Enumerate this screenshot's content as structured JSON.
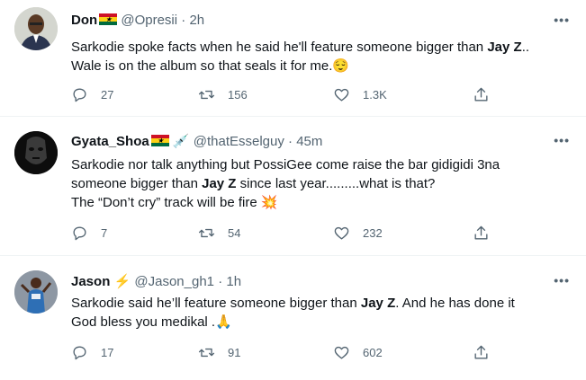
{
  "tweets": [
    {
      "name": "Don",
      "handle": "@Opresii",
      "dot": "·",
      "time": "2h",
      "text_before": "Sarkodie spoke facts when he said he'll feature someone bigger than ",
      "bold": "Jay Z",
      "text_after": "..",
      "line2": "Wale is on the album so that seals it for me.",
      "reply_count": "27",
      "retweet_count": "156",
      "like_count": "1.3K",
      "avatar_icon": "avatar-man-suit"
    },
    {
      "name": "Gyata_Shoa",
      "handle": "@thatEsselguy",
      "dot": "·",
      "time": "45m",
      "text_before": "Sarkodie nor talk anything but PossiGee come  raise the bar gidigidi 3na",
      "line2_before": "someone bigger than ",
      "bold": "Jay Z",
      "line2_after": " since last year.........what is that?",
      "line3": "The “Don’t cry” track will be fire",
      "reply_count": "7",
      "retweet_count": "54",
      "like_count": "232",
      "avatar_icon": "avatar-mask"
    },
    {
      "name": "Jason",
      "handle": "@Jason_gh1",
      "dot": "·",
      "time": "1h",
      "text_before": "Sarkodie said he’ll feature someone bigger than ",
      "bold": "Jay Z",
      "text_after": ". And he has done it",
      "line2": "God bless you  medikal .",
      "reply_count": "17",
      "retweet_count": "91",
      "like_count": "602",
      "avatar_icon": "avatar-basketball-player"
    }
  ],
  "colors": {
    "text": "#0f1419",
    "secondary": "#536471",
    "divider": "#eff3f4",
    "ghana_red": "#ce1126",
    "ghana_gold": "#fcd116",
    "ghana_green": "#006b3f",
    "lightning": "#f4b400"
  },
  "icons": {
    "reply": "reply-icon",
    "retweet": "retweet-icon",
    "like": "like-icon",
    "share": "share-icon",
    "more": "more-icon"
  },
  "more_label": "•••"
}
